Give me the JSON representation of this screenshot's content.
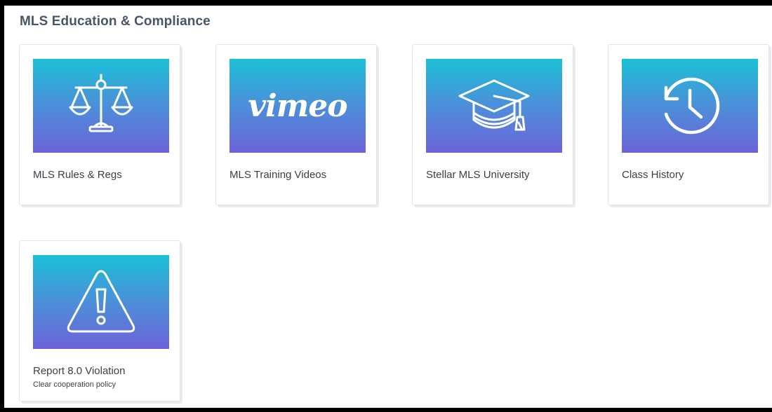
{
  "section": {
    "title": "MLS Education & Compliance"
  },
  "tiles": [
    {
      "label": "MLS Rules & Regs",
      "icon": "scales-icon"
    },
    {
      "label": "MLS Training Videos",
      "icon": "vimeo-logo",
      "logo_text": "vimeo"
    },
    {
      "label": "Stellar MLS University",
      "icon": "graduation-cap-icon"
    },
    {
      "label": "Class History",
      "icon": "history-clock-icon"
    },
    {
      "label": "Report 8.0 Violation",
      "sublabel": "Clear cooperation policy",
      "icon": "warning-icon"
    }
  ],
  "colors": {
    "gradient_top": "#1ac0d6",
    "gradient_bottom": "#6c63d8",
    "title_text": "#4a5568",
    "label_text": "#3a3f45"
  }
}
